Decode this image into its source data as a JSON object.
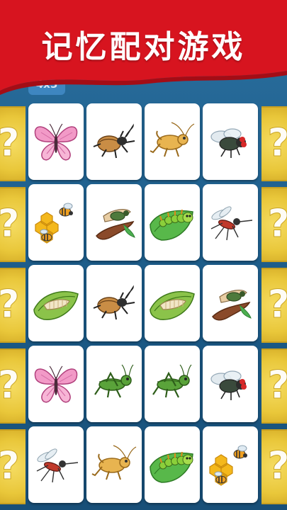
{
  "header": {
    "title": "记忆配对游戏"
  },
  "grid_size": "4x5",
  "side_tile_symbol": "?",
  "colors": {
    "banner_red": "#d7141f",
    "board_blue": "#1e5e8c",
    "side_yellow": "#e9c73a"
  },
  "cards": [
    {
      "creature": "butterfly"
    },
    {
      "creature": "beetle"
    },
    {
      "creature": "cricket"
    },
    {
      "creature": "fly"
    },
    {
      "creature": "bees"
    },
    {
      "creature": "cicada"
    },
    {
      "creature": "caterpillar"
    },
    {
      "creature": "mosquito"
    },
    {
      "creature": "larva"
    },
    {
      "creature": "beetle"
    },
    {
      "creature": "larva"
    },
    {
      "creature": "cicada"
    },
    {
      "creature": "butterfly"
    },
    {
      "creature": "grasshopper"
    },
    {
      "creature": "grasshopper"
    },
    {
      "creature": "fly"
    },
    {
      "creature": "mosquito"
    },
    {
      "creature": "cricket"
    },
    {
      "creature": "caterpillar"
    },
    {
      "creature": "bees"
    }
  ]
}
